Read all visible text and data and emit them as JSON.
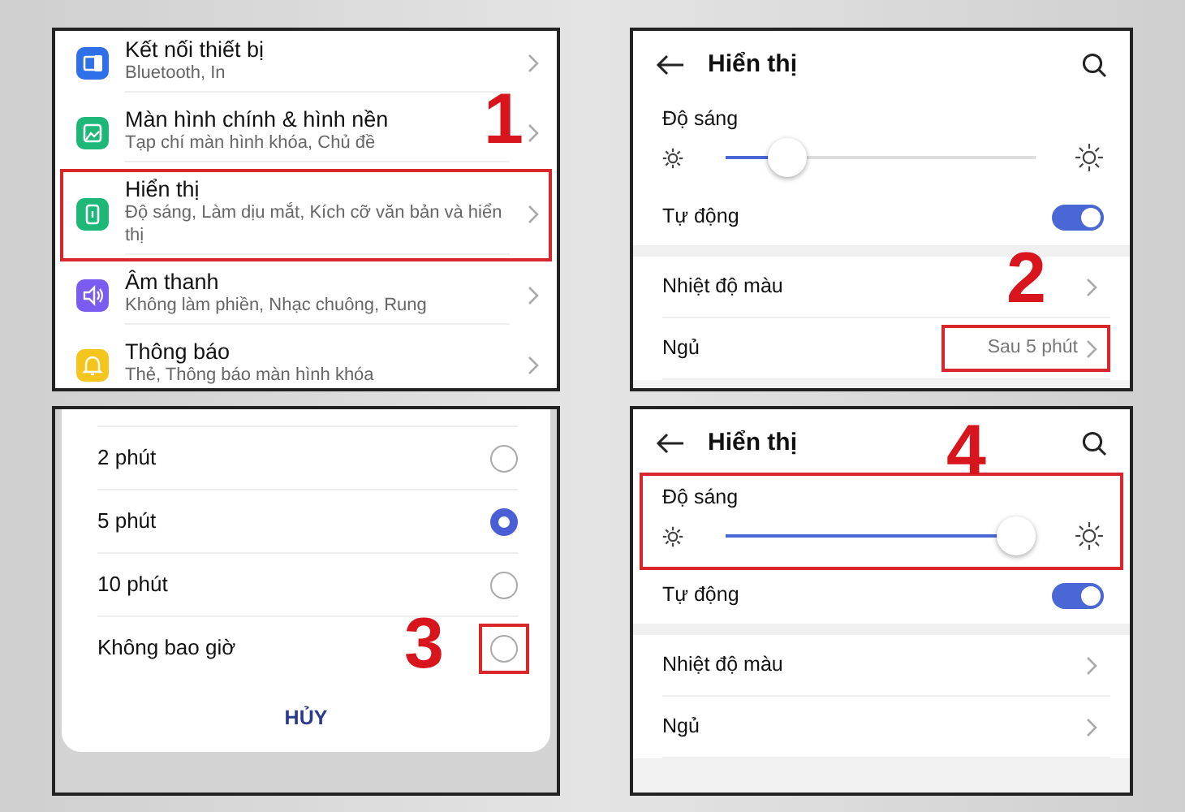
{
  "panels": [
    {
      "kind": "settings_list",
      "step": "1",
      "items": [
        {
          "title": "Kết nối thiết bị",
          "subtitle": "Bluetooth, In",
          "color": "#2f6fe8",
          "highlighted": false
        },
        {
          "title": "Màn hình chính & hình nền",
          "subtitle": "Tạp chí màn hình khóa, Chủ đề",
          "color": "#1db877",
          "highlighted": false
        },
        {
          "title": "Hiển thị",
          "subtitle": "Độ sáng, Làm dịu mắt, Kích cỡ văn bản và hiển thị",
          "color": "#1db877",
          "highlighted": true
        },
        {
          "title": "Âm thanh",
          "subtitle": "Không làm phiền, Nhạc chuông, Rung",
          "color": "#7a5cf0",
          "highlighted": false
        },
        {
          "title": "Thông báo",
          "subtitle": "Thẻ, Thông báo màn hình khóa",
          "color": "#f4c51c",
          "highlighted": false
        }
      ]
    },
    {
      "kind": "display",
      "step": "2",
      "title": "Hiển thị",
      "brightness": {
        "label": "Độ sáng",
        "level": 0.2,
        "highlighted": false
      },
      "auto": {
        "label": "Tự động",
        "on": true
      },
      "rows": [
        {
          "label": "Nhiệt độ màu",
          "highlighted": false
        },
        {
          "label": "Ngủ",
          "value": "Sau 5 phút",
          "highlighted": true
        }
      ]
    },
    {
      "kind": "radio_dialog",
      "step": "3",
      "options": [
        {
          "label": "2 phút",
          "selected": false,
          "highlighted": false
        },
        {
          "label": "5 phút",
          "selected": true,
          "highlighted": false
        },
        {
          "label": "10 phút",
          "selected": false,
          "highlighted": false
        },
        {
          "label": "Không bao giờ",
          "selected": false,
          "highlighted": true
        }
      ],
      "cancel": "HỦY"
    },
    {
      "kind": "display",
      "step": "4",
      "title": "Hiển thị",
      "brightness": {
        "label": "Độ sáng",
        "level": 0.97,
        "highlighted": true
      },
      "auto": {
        "label": "Tự động",
        "on": true
      },
      "rows": [
        {
          "label": "Nhiệt độ màu",
          "highlighted": false
        },
        {
          "label": "Ngủ",
          "highlighted": false
        }
      ]
    }
  ]
}
